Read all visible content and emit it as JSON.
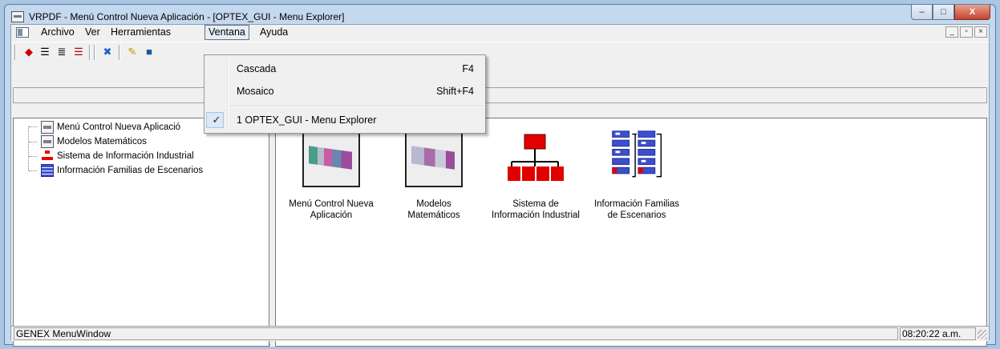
{
  "window": {
    "title": "VRPDF - Menú Control Nueva Aplicación - [OPTEX_GUI - Menu Explorer]",
    "controls": {
      "minimize": "–",
      "maximize": "□",
      "close": "X"
    }
  },
  "menubar": {
    "items": [
      {
        "label": "Archivo"
      },
      {
        "label": "Ver"
      },
      {
        "label": "Herramientas"
      },
      {
        "label": "Ventana"
      },
      {
        "label": "Ayuda"
      }
    ],
    "mdi_controls": {
      "minimize": "_",
      "restore": "▫",
      "close": "×"
    }
  },
  "dropdown": {
    "items": [
      {
        "label": "Cascada",
        "shortcut": "F4"
      },
      {
        "label": "Mosaico",
        "shortcut": "Shift+F4"
      },
      {
        "label": "1 OPTEX_GUI - Menu Explorer",
        "checked": "✓"
      }
    ]
  },
  "tree": {
    "items": [
      {
        "label": "Menú Control Nueva Aplicació",
        "icon": "app-gray-icon"
      },
      {
        "label": "Modelos Matemáticos",
        "icon": "app-gray-icon"
      },
      {
        "label": "Sistema de Información Industrial",
        "icon": "org-chart-icon"
      },
      {
        "label": "Información Familias de Escenarios",
        "icon": "blue-blocks-icon"
      }
    ]
  },
  "icons": {
    "items": [
      {
        "label1": "Menú Control Nueva",
        "label2": "Aplicación"
      },
      {
        "label1": "Modelos",
        "label2": "Matemáticos"
      },
      {
        "label1": "Sistema de",
        "label2": "Información Industrial"
      },
      {
        "label1": "Información Familias",
        "label2": "de Escenarios"
      }
    ]
  },
  "statusbar": {
    "left": "GENEX MenuWindow",
    "time": "08:20:22 a.m."
  },
  "colors": {
    "accent_red": "#e00000",
    "accent_blue": "#3d4fd0"
  }
}
